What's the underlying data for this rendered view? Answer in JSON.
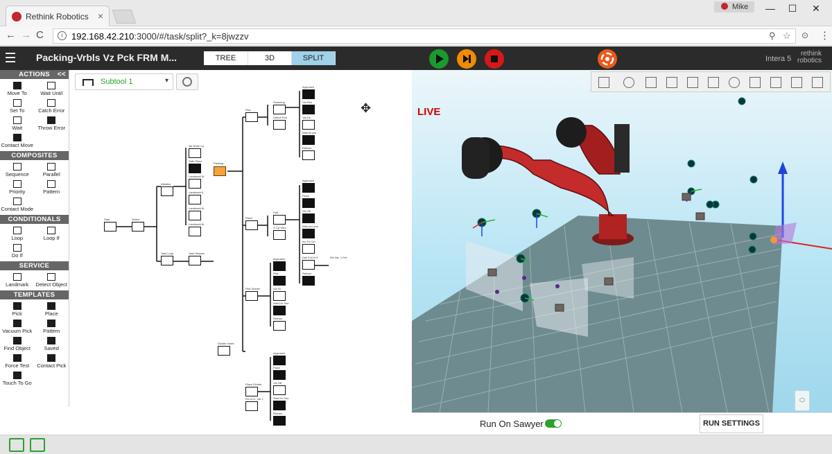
{
  "browser": {
    "tab_title": "Rethink Robotics",
    "close_glyph": "×",
    "user_name": "Mike",
    "url_host": "192.168.42.210",
    "url_path": ":3000/#/task/split?_k=8jwzzv",
    "window_controls": {
      "minimize": "—",
      "maximize": "☐",
      "close": "✕"
    },
    "nav": {
      "back": "←",
      "forward": "→",
      "reload": "C"
    },
    "url_icons": {
      "info": "i",
      "search": "⚲",
      "star": "☆",
      "ext": "⊙",
      "menu": "⋮"
    }
  },
  "header": {
    "project_title": "Packing-Vrbls Vz Pck FRM M...",
    "tabs": [
      {
        "label": "TREE",
        "active": false
      },
      {
        "label": "3D",
        "active": false
      },
      {
        "label": "SPLIT",
        "active": true
      }
    ],
    "robot_model": "Intera 5",
    "brand_line1": "rethink",
    "brand_line2": "robotics",
    "colors": {
      "play": "#1a9a2c",
      "step": "#f08c00",
      "stop": "#d71818",
      "accent": "#2da12d"
    }
  },
  "palette": {
    "collapse": "<<",
    "sections": [
      {
        "title": "ACTIONS",
        "items": [
          "Move To",
          "Wait Until",
          "Set To",
          "Catch Error",
          "Wait",
          "Throw Error",
          "Contact Move"
        ]
      },
      {
        "title": "COMPOSITES",
        "items": [
          "Sequence",
          "Parallel",
          "Priority",
          "Pattern",
          "Contact Mode"
        ]
      },
      {
        "title": "CONDITIONALS",
        "items": [
          "Loop",
          "Loop If",
          "Do If"
        ]
      },
      {
        "title": "SERVICE",
        "items": [
          "Landmark",
          "Detect Object"
        ]
      },
      {
        "title": "TEMPLATES",
        "items": [
          "Pick",
          "Place",
          "Vacuum Pick",
          "Pattern",
          "Find Object",
          "Saved",
          "Force Test",
          "Contact Pick",
          "Touch To Go"
        ]
      }
    ]
  },
  "canvas": {
    "subtool_label": "Subtool 1",
    "caret": "▾",
    "move_cursor": "✥",
    "nodes": {
      "start": "Start",
      "select": "Select",
      "initialize": "Initialize",
      "task_loop": "Task Loop",
      "init_node": "Init Node Cy",
      "safe_place": "Safe Place",
      "landmark_5": "Landmark 5i",
      "landmark_6": "Landmark 6",
      "landmark_5b": "Landmark 5i",
      "landmark_5c": "Landmark 5i",
      "task_sequence": "Task Sequen",
      "packing": "Packing",
      "pick": "Pick",
      "place": "Place",
      "scanning": "Scanning",
      "detect_part": "Detect Part",
      "hub": "Hub",
      "cycle_vertex": "Z Cyl Vtex",
      "approach1": "Approach",
      "via_pick": "Via Pick",
      "via_dn": "Via Dn",
      "wait_till": "Wait till yno",
      "retract1": "Retract",
      "approach2": "Approach",
      "place2": "Place",
      "via_off": "Via Off",
      "wait_yno": "Wait yno yno",
      "inc_fn": "Inc Fn Cnt",
      "dell_fn": "Dell FnCnt 3",
      "ele_var": "Ele Var: 1 Pnt",
      "approach3": "Approach",
      "pick3": "Pick",
      "retract3": "Retract",
      "pick_divider": "Pick Divider",
      "via_sc": "Via Sc",
      "wait_dn": "Wait Dn Sno",
      "retract4": "Retract",
      "divider_insert": "Divider Insert",
      "approach5": "Approach",
      "place5": "Place",
      "via_off5": "Via Off",
      "wait_dn5": "Wait Dn Sno",
      "retract5": "Retract",
      "place_divider": "Place Divider",
      "div_var": "Div to D. Var 1"
    }
  },
  "scene": {
    "live_label": "LIVE",
    "zoom_up": "︿",
    "zoom_down": "﹀"
  },
  "runbar": {
    "run_on_label": "Run On Sawyer",
    "run_on_enabled": true,
    "settings_button": "RUN SETTINGS"
  }
}
